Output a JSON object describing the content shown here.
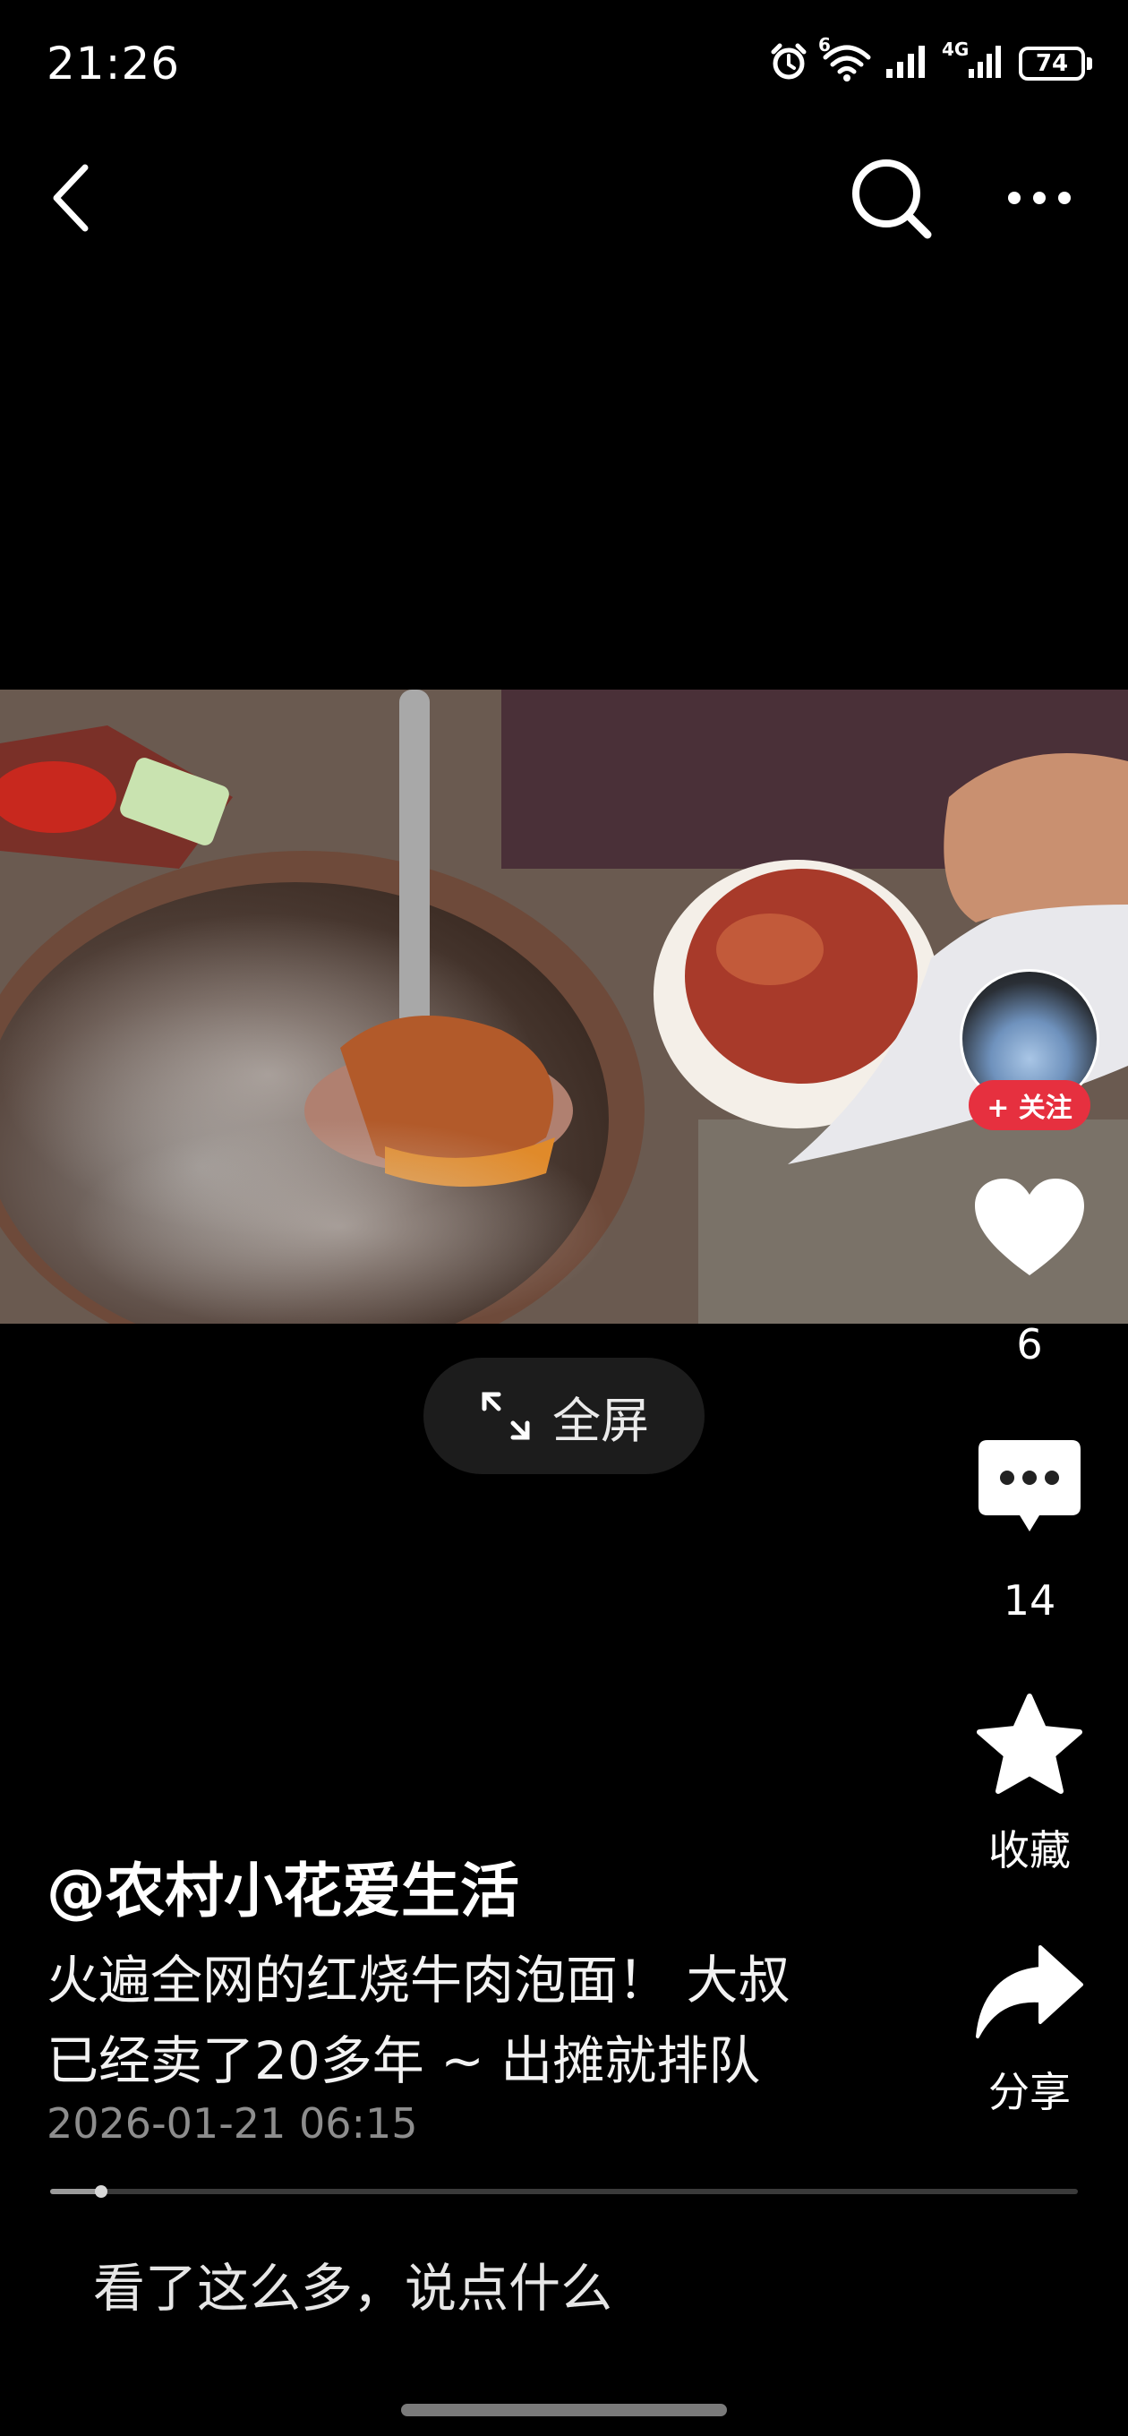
{
  "status_bar": {
    "time": "21:26",
    "wifi_badge": "6",
    "cell_badge": "4G",
    "battery": "74"
  },
  "video": {
    "progress": 0.05
  },
  "fullscreen": {
    "label": "全屏"
  },
  "rail": {
    "follow_label": "+ 关注",
    "likes": "6",
    "comments": "14",
    "favorite_label": "收藏",
    "share_label": "分享"
  },
  "caption": {
    "author": "@农村小花爱生活",
    "line1": "火遍全网的红烧牛肉泡面！  大叔",
    "line2": "已经卖了20多年 ~ 出摊就排队",
    "timestamp": "2026-01-21 06:15"
  },
  "comment": {
    "placeholder": "看了这么多，说点什么"
  },
  "colors": {
    "follow": "#e6303f",
    "background": "#000000"
  }
}
